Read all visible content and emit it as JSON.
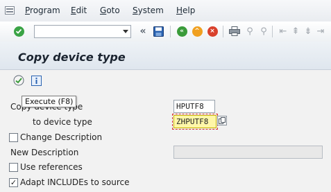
{
  "menu": {
    "items": [
      "Program",
      "Edit",
      "Goto",
      "System",
      "Help"
    ],
    "mnemonics": [
      "P",
      "E",
      "G",
      "S",
      "H"
    ]
  },
  "toolbar": {
    "command_field": {
      "value": "",
      "placeholder": ""
    },
    "enter_icon": "check-icon",
    "save_icon": "save-icon",
    "back_icon": "back-icon",
    "exit_icon": "exit-icon",
    "cancel_icon": "cancel-icon"
  },
  "page": {
    "title": "Copy device type"
  },
  "app_toolbar": {
    "execute_icon": "execute-icon",
    "info_icon": "info-icon",
    "tooltip": "Execute  (F8)"
  },
  "form": {
    "copy_device_type": {
      "label": "Copy device type",
      "value": "HPUTF8"
    },
    "to_device_type": {
      "label": "to device type",
      "value": "ZHPUTF8"
    },
    "change_description": {
      "label": "Change Description",
      "checked": false
    },
    "new_description": {
      "label": "New Description",
      "value": ""
    },
    "use_references": {
      "label": "Use references",
      "checked": false
    },
    "adapt_includes": {
      "label": "Adapt INCLUDEs to source",
      "checked": true,
      "mark": "✓"
    }
  },
  "colors": {
    "required_field": "#fff7a8",
    "focus_border": "#d4342c",
    "enter_green": "#3aa345",
    "back_green": "#3a9b3a",
    "exit_orange": "#f0a020",
    "cancel_red": "#d9412c",
    "save_blue": "#2a62b0"
  }
}
